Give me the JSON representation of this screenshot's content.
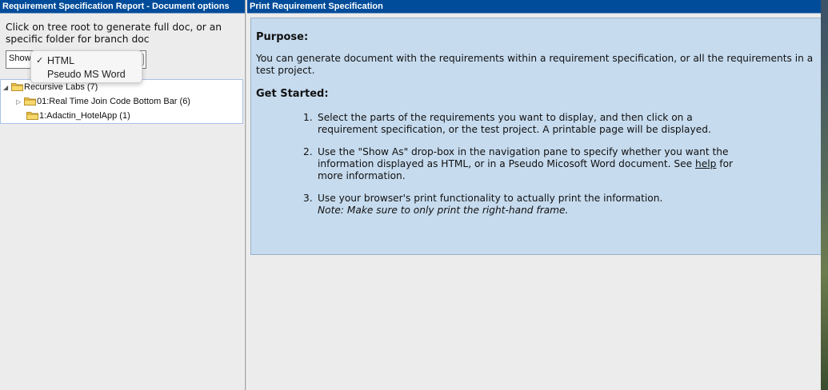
{
  "left": {
    "title": "Requirement Specification Report - Document options",
    "instructions": "Click on tree root to generate full doc, or an specific folder for branch doc",
    "show_as_label": "Show",
    "show_as_options": [
      {
        "label": "HTML",
        "selected": true
      },
      {
        "label": "Pseudo MS Word",
        "selected": false
      }
    ],
    "tree": [
      {
        "label": "Recursive Labs (7)",
        "expanded": true,
        "level": 0
      },
      {
        "label": "01:Real Time Join Code Bottom Bar (6)",
        "expanded": false,
        "level": 1
      },
      {
        "label": "1:Adactin_HotelApp (1)",
        "expanded": false,
        "level": 1
      }
    ]
  },
  "right": {
    "title": "Print Requirement Specification",
    "purpose_heading": "Purpose:",
    "purpose_text": "You can generate document with the requirements within a requirement specification, or all the requirements in a test project.",
    "started_heading": "Get Started:",
    "steps": [
      {
        "num": "1.",
        "text": "Select the parts of the requirements you want to display, and then click on a requirement specification, or the test project. A printable page will be displayed."
      },
      {
        "num": "2.",
        "text_before": "Use the \"Show As\" drop-box in the navigation pane to specify whether you want the information displayed as HTML, or in a Pseudo Micosoft Word document. See ",
        "link": "help",
        "text_after": " for more information."
      },
      {
        "num": "3.",
        "text": "Use your browser's print functionality to actually print the information.",
        "note": "Note: Make sure to only print the right-hand frame."
      }
    ]
  },
  "icons": {
    "folder": "folder-icon",
    "expanded": "triangle-down-icon",
    "collapsed": "triangle-right-icon",
    "check": "check-icon"
  },
  "colors": {
    "titlebar": "#004c9a",
    "panel": "#c6dbee",
    "tree_border": "#a9c1e8",
    "folder": "#f2c94c"
  }
}
